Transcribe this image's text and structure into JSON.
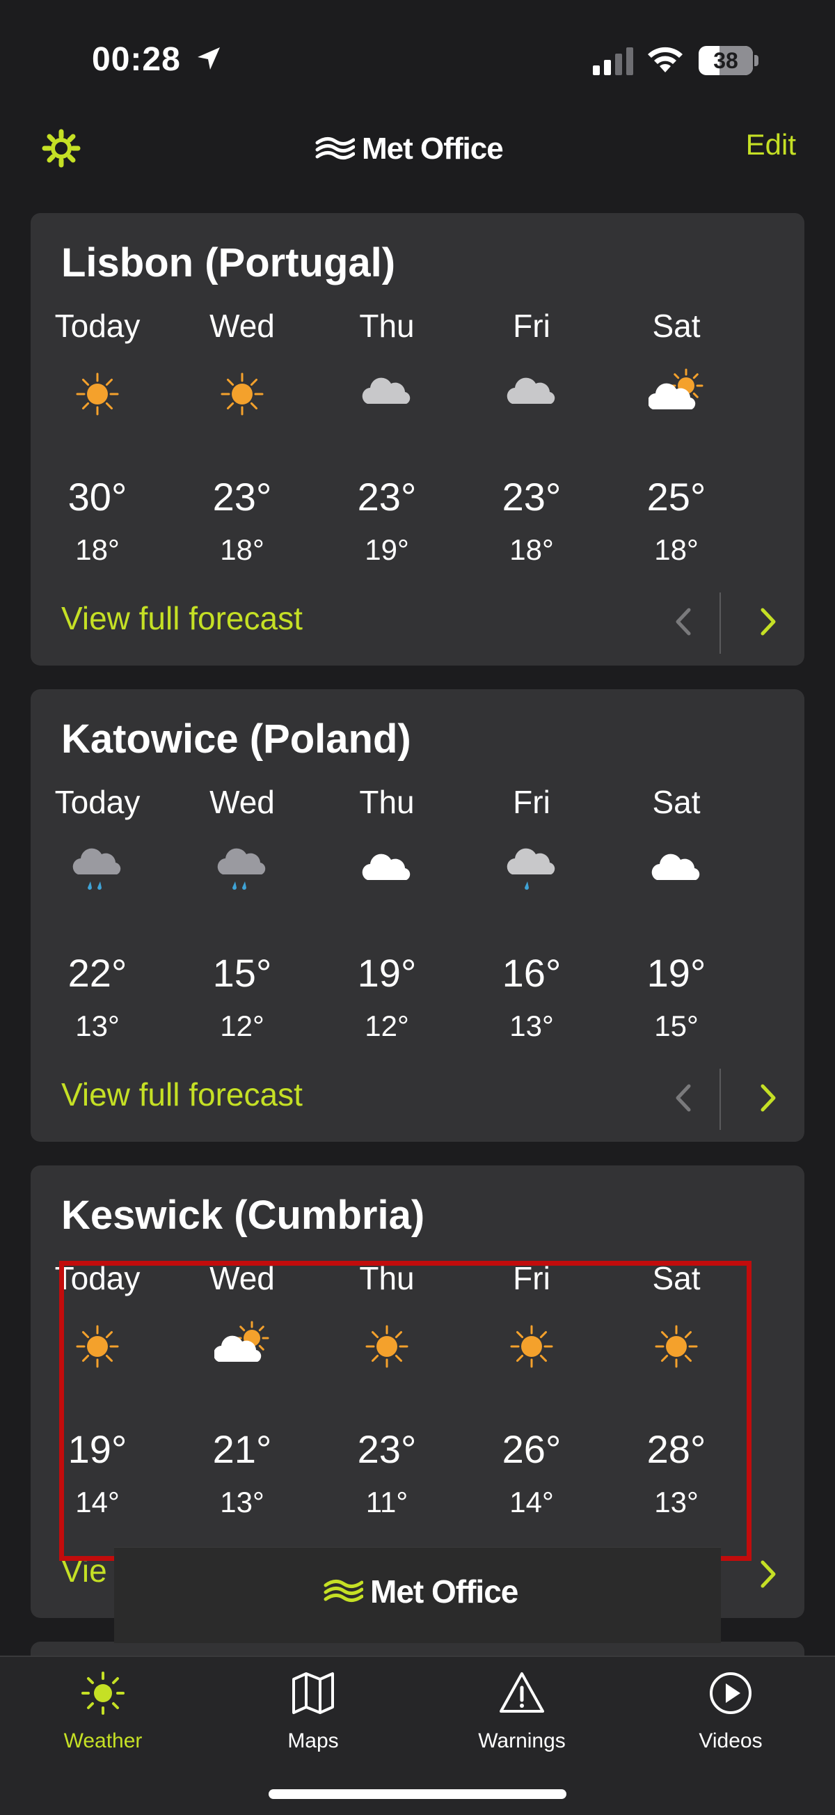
{
  "status_bar": {
    "time": "00:28",
    "battery": "38",
    "battery_level": 0.38
  },
  "header": {
    "logo_text": "Met Office",
    "edit_label": "Edit"
  },
  "cards": [
    {
      "title": "Lisbon (Portugal)",
      "days": [
        {
          "name": "Today",
          "icon": "sun",
          "high": "30°",
          "low": "18°"
        },
        {
          "name": "Wed",
          "icon": "sun",
          "high": "23°",
          "low": "18°"
        },
        {
          "name": "Thu",
          "icon": "cloud-grey",
          "high": "23°",
          "low": "19°"
        },
        {
          "name": "Fri",
          "icon": "cloud-grey",
          "high": "23°",
          "low": "18°"
        },
        {
          "name": "Sat",
          "icon": "sun-cloud",
          "high": "25°",
          "low": "18°"
        }
      ],
      "link": "View full forecast"
    },
    {
      "title": "Katowice (Poland)",
      "days": [
        {
          "name": "Today",
          "icon": "rain-cloud",
          "high": "22°",
          "low": "13°"
        },
        {
          "name": "Wed",
          "icon": "rain-cloud",
          "high": "15°",
          "low": "12°"
        },
        {
          "name": "Thu",
          "icon": "cloud-white",
          "high": "19°",
          "low": "12°"
        },
        {
          "name": "Fri",
          "icon": "light-rain-cloud",
          "high": "16°",
          "low": "13°"
        },
        {
          "name": "Sat",
          "icon": "cloud-white",
          "high": "19°",
          "low": "15°"
        }
      ],
      "link": "View full forecast"
    },
    {
      "title": "Keswick (Cumbria)",
      "days": [
        {
          "name": "Today",
          "icon": "sun",
          "high": "19°",
          "low": "14°"
        },
        {
          "name": "Wed",
          "icon": "sun-cloud",
          "high": "21°",
          "low": "13°"
        },
        {
          "name": "Thu",
          "icon": "sun",
          "high": "23°",
          "low": "11°"
        },
        {
          "name": "Fri",
          "icon": "sun",
          "high": "26°",
          "low": "14°"
        },
        {
          "name": "Sat",
          "icon": "sun",
          "high": "28°",
          "low": "13°"
        }
      ],
      "link": "View full forecast",
      "link_visible": "Vie"
    }
  ],
  "toast": {
    "logo_text": "Met Office"
  },
  "tabs": [
    {
      "label": "Weather",
      "icon": "sun-icon",
      "active": true
    },
    {
      "label": "Maps",
      "icon": "map-icon",
      "active": false
    },
    {
      "label": "Warnings",
      "icon": "warning-icon",
      "active": false
    },
    {
      "label": "Videos",
      "icon": "play-icon",
      "active": false
    }
  ],
  "colors": {
    "accent": "#c5e025",
    "sun": "#f4a12c",
    "card": "#333335",
    "background": "#1c1c1e",
    "highlight": "#c20c0c"
  }
}
